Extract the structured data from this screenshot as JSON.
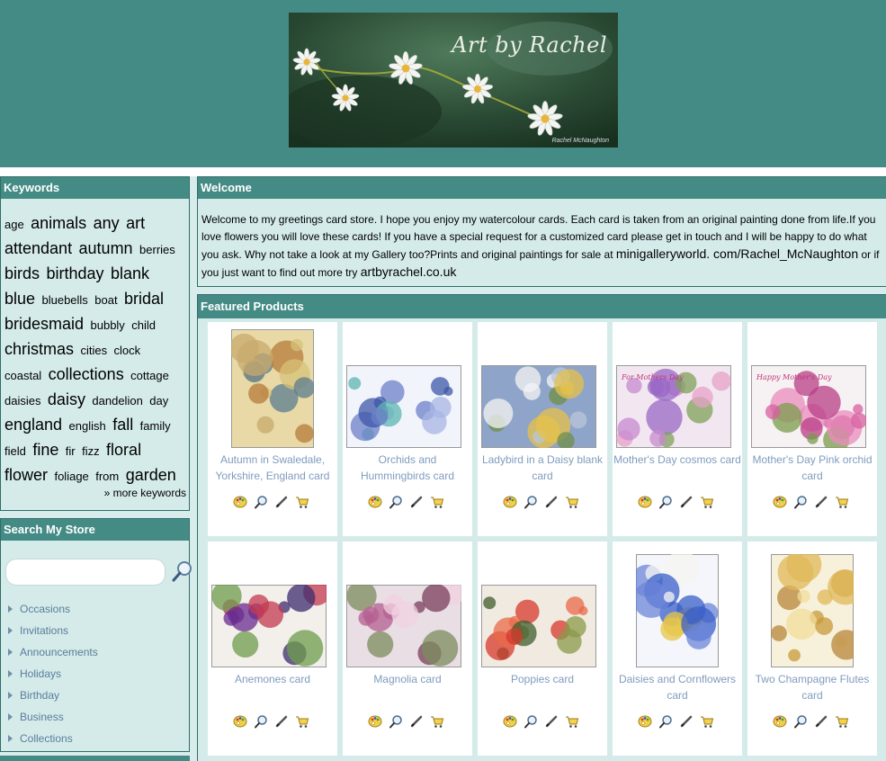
{
  "header": {
    "banner_title": "Art by Rachel",
    "banner_signature": "Rachel McNaughton"
  },
  "keywords": {
    "heading": "Keywords",
    "tags": [
      {
        "text": "age",
        "size": 1
      },
      {
        "text": "animals",
        "size": 2
      },
      {
        "text": "any",
        "size": 2
      },
      {
        "text": "art",
        "size": 2
      },
      {
        "text": "attendant",
        "size": 2
      },
      {
        "text": "autumn",
        "size": 2
      },
      {
        "text": "berries",
        "size": 1
      },
      {
        "text": "birds",
        "size": 2
      },
      {
        "text": "birthday",
        "size": 2
      },
      {
        "text": "blank",
        "size": 2
      },
      {
        "text": "blue",
        "size": 2
      },
      {
        "text": "bluebells",
        "size": 1
      },
      {
        "text": "boat",
        "size": 1
      },
      {
        "text": "bridal",
        "size": 2
      },
      {
        "text": "bridesmaid",
        "size": 2
      },
      {
        "text": "bubbly",
        "size": 1
      },
      {
        "text": "child",
        "size": 1
      },
      {
        "text": "christmas",
        "size": 2
      },
      {
        "text": "cities",
        "size": 1
      },
      {
        "text": "clock",
        "size": 1
      },
      {
        "text": "coastal",
        "size": 1
      },
      {
        "text": "collections",
        "size": 2
      },
      {
        "text": "cottage",
        "size": 1
      },
      {
        "text": "daisies",
        "size": 1
      },
      {
        "text": "daisy",
        "size": 2
      },
      {
        "text": "dandelion",
        "size": 1
      },
      {
        "text": "day",
        "size": 1
      },
      {
        "text": "england",
        "size": 2
      },
      {
        "text": "english",
        "size": 1
      },
      {
        "text": "fall",
        "size": 2
      },
      {
        "text": "family",
        "size": 1
      },
      {
        "text": "field",
        "size": 1
      },
      {
        "text": "fine",
        "size": 2
      },
      {
        "text": "fir",
        "size": 1
      },
      {
        "text": "fizz",
        "size": 1
      },
      {
        "text": "floral",
        "size": 2
      },
      {
        "text": "flower",
        "size": 2
      },
      {
        "text": "foliage",
        "size": 1
      },
      {
        "text": "from",
        "size": 1
      },
      {
        "text": "garden",
        "size": 2
      }
    ],
    "more_label": "» more keywords"
  },
  "search": {
    "heading": "Search My Store",
    "placeholder": "",
    "categories": [
      "Occasions",
      "Invitations",
      "Announcements",
      "Holidays",
      "Birthday",
      "Business",
      "Collections"
    ]
  },
  "welcome": {
    "heading": "Welcome",
    "text": "Welcome to my greetings card store. I hope you enjoy my watercolour cards. Each card is taken from an original painting done from life.If you love flowers you will love these cards! If you have a special request for a customized card please get in touch and I will be happy to do what you ask. Why not take a look at my Gallery too?Prints and original paintings for sale at ",
    "link1": "minigalleryworld. com/Rachel_McNaughton",
    "middle": " or if you just want to find out more try ",
    "link2": "artbyrachel.co.uk"
  },
  "featured": {
    "heading": "Featured Products",
    "products": [
      {
        "title": "Autumn in Swaledale, Yorkshire, England card",
        "art": "autumn"
      },
      {
        "title": "Orchids and Hummingbirds card",
        "art": "orchids"
      },
      {
        "title": "Ladybird in a Daisy blank card",
        "art": "daisy"
      },
      {
        "title": "Mother's Day cosmos card",
        "art": "cosmos",
        "card_text": "For Mothers Day"
      },
      {
        "title": "Mother's Day Pink orchid card",
        "art": "pinkorchid",
        "card_text": "Happy Mother's Day"
      },
      {
        "title": "Anemones card",
        "art": "anemones"
      },
      {
        "title": "Magnolia card",
        "art": "magnolia"
      },
      {
        "title": "Poppies card",
        "art": "poppies"
      },
      {
        "title": "Daisies and Cornflowers card",
        "art": "cornflowers"
      },
      {
        "title": "Two Champagne Flutes card",
        "art": "champagne"
      }
    ],
    "icons": [
      "palette-icon",
      "magnify-icon",
      "pencil-icon",
      "cart-icon"
    ]
  },
  "colors": {
    "header_bg": "#458b85",
    "panel_bg": "#d4ebea",
    "link_color": "#7e9cbd"
  }
}
